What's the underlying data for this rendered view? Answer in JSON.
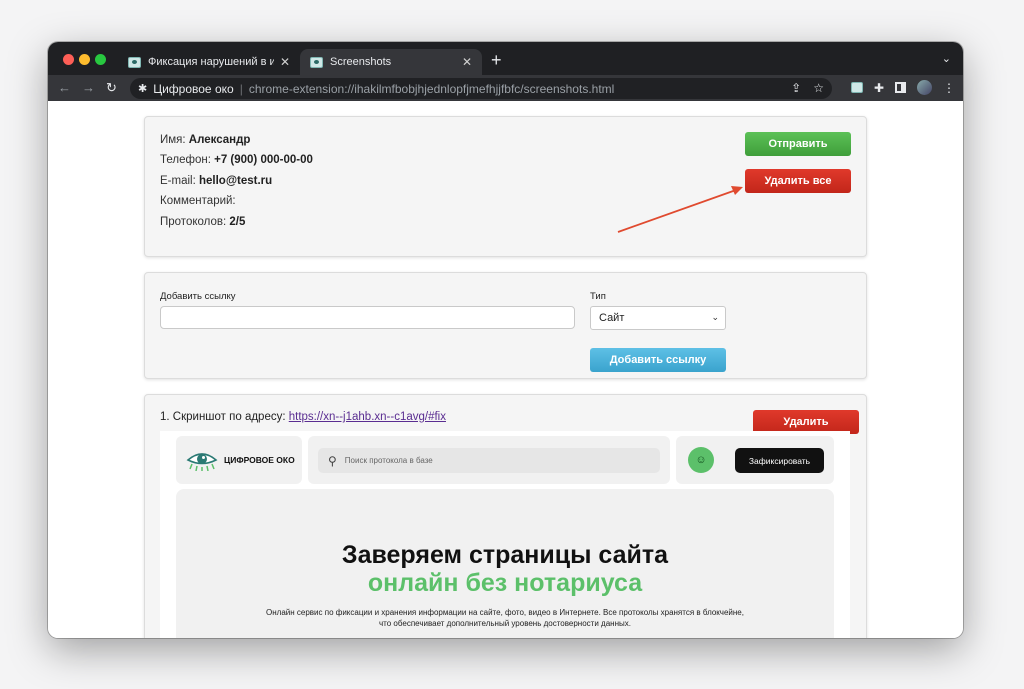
{
  "browser": {
    "tabs": [
      {
        "title": "Фиксация нарушений в интер",
        "close": "✕"
      },
      {
        "title": "Screenshots",
        "close": "✕"
      }
    ],
    "new_tab": "+",
    "tabs_menu": "⌄",
    "nav": {
      "back": "←",
      "forward": "→",
      "reload": "↻"
    },
    "origin": "Цифровое око",
    "separator": "|",
    "url": "chrome-extension://ihakilmfbobjhjednlopfjmefhjjfbfc/screenshots.html"
  },
  "info": {
    "name_label": "Имя: ",
    "name_value": "Александр",
    "phone_label": "Телефон: ",
    "phone_value": "+7 (900) 000-00-00",
    "email_label": "E-mail: ",
    "email_value": "hello@test.ru",
    "comment_label": "Комментарий:",
    "protocols_label": "Протоколов: ",
    "protocols_value": "2/5",
    "send_button": "Отправить",
    "delete_all_button": "Удалить все"
  },
  "add_link": {
    "link_label": "Добавить ссылку",
    "link_value": "",
    "type_label": "Тип",
    "type_selected": "Сайт",
    "add_button": "Добавить ссылку"
  },
  "screenshot": {
    "prefix": "1. Скриншот по адресу: ",
    "url": "https://xn--j1ahb.xn--c1avg/#fix",
    "delete_button": "Удалить",
    "site": {
      "logo_text": "ЦИФРОВОЕ ОКО",
      "search_placeholder": "Поиск протокола в базе",
      "fix_button": "Зафиксировать",
      "hero_title": "Заверяем страницы сайта",
      "hero_title_accent": "онлайн без нотариуса",
      "hero_subtitle": "Онлайн сервис по фиксации и хранения информации на сайте, фото, видео в Интернете. Все протоколы хранятся в блокчейне, что обеспечивает дополнительный уровень достоверности данных."
    }
  },
  "colors": {
    "send": "#4cae47",
    "danger": "#d12f22",
    "info": "#47b0d9",
    "brand_green": "#5cc06a",
    "annotation_arrow": "#e04a2f"
  }
}
